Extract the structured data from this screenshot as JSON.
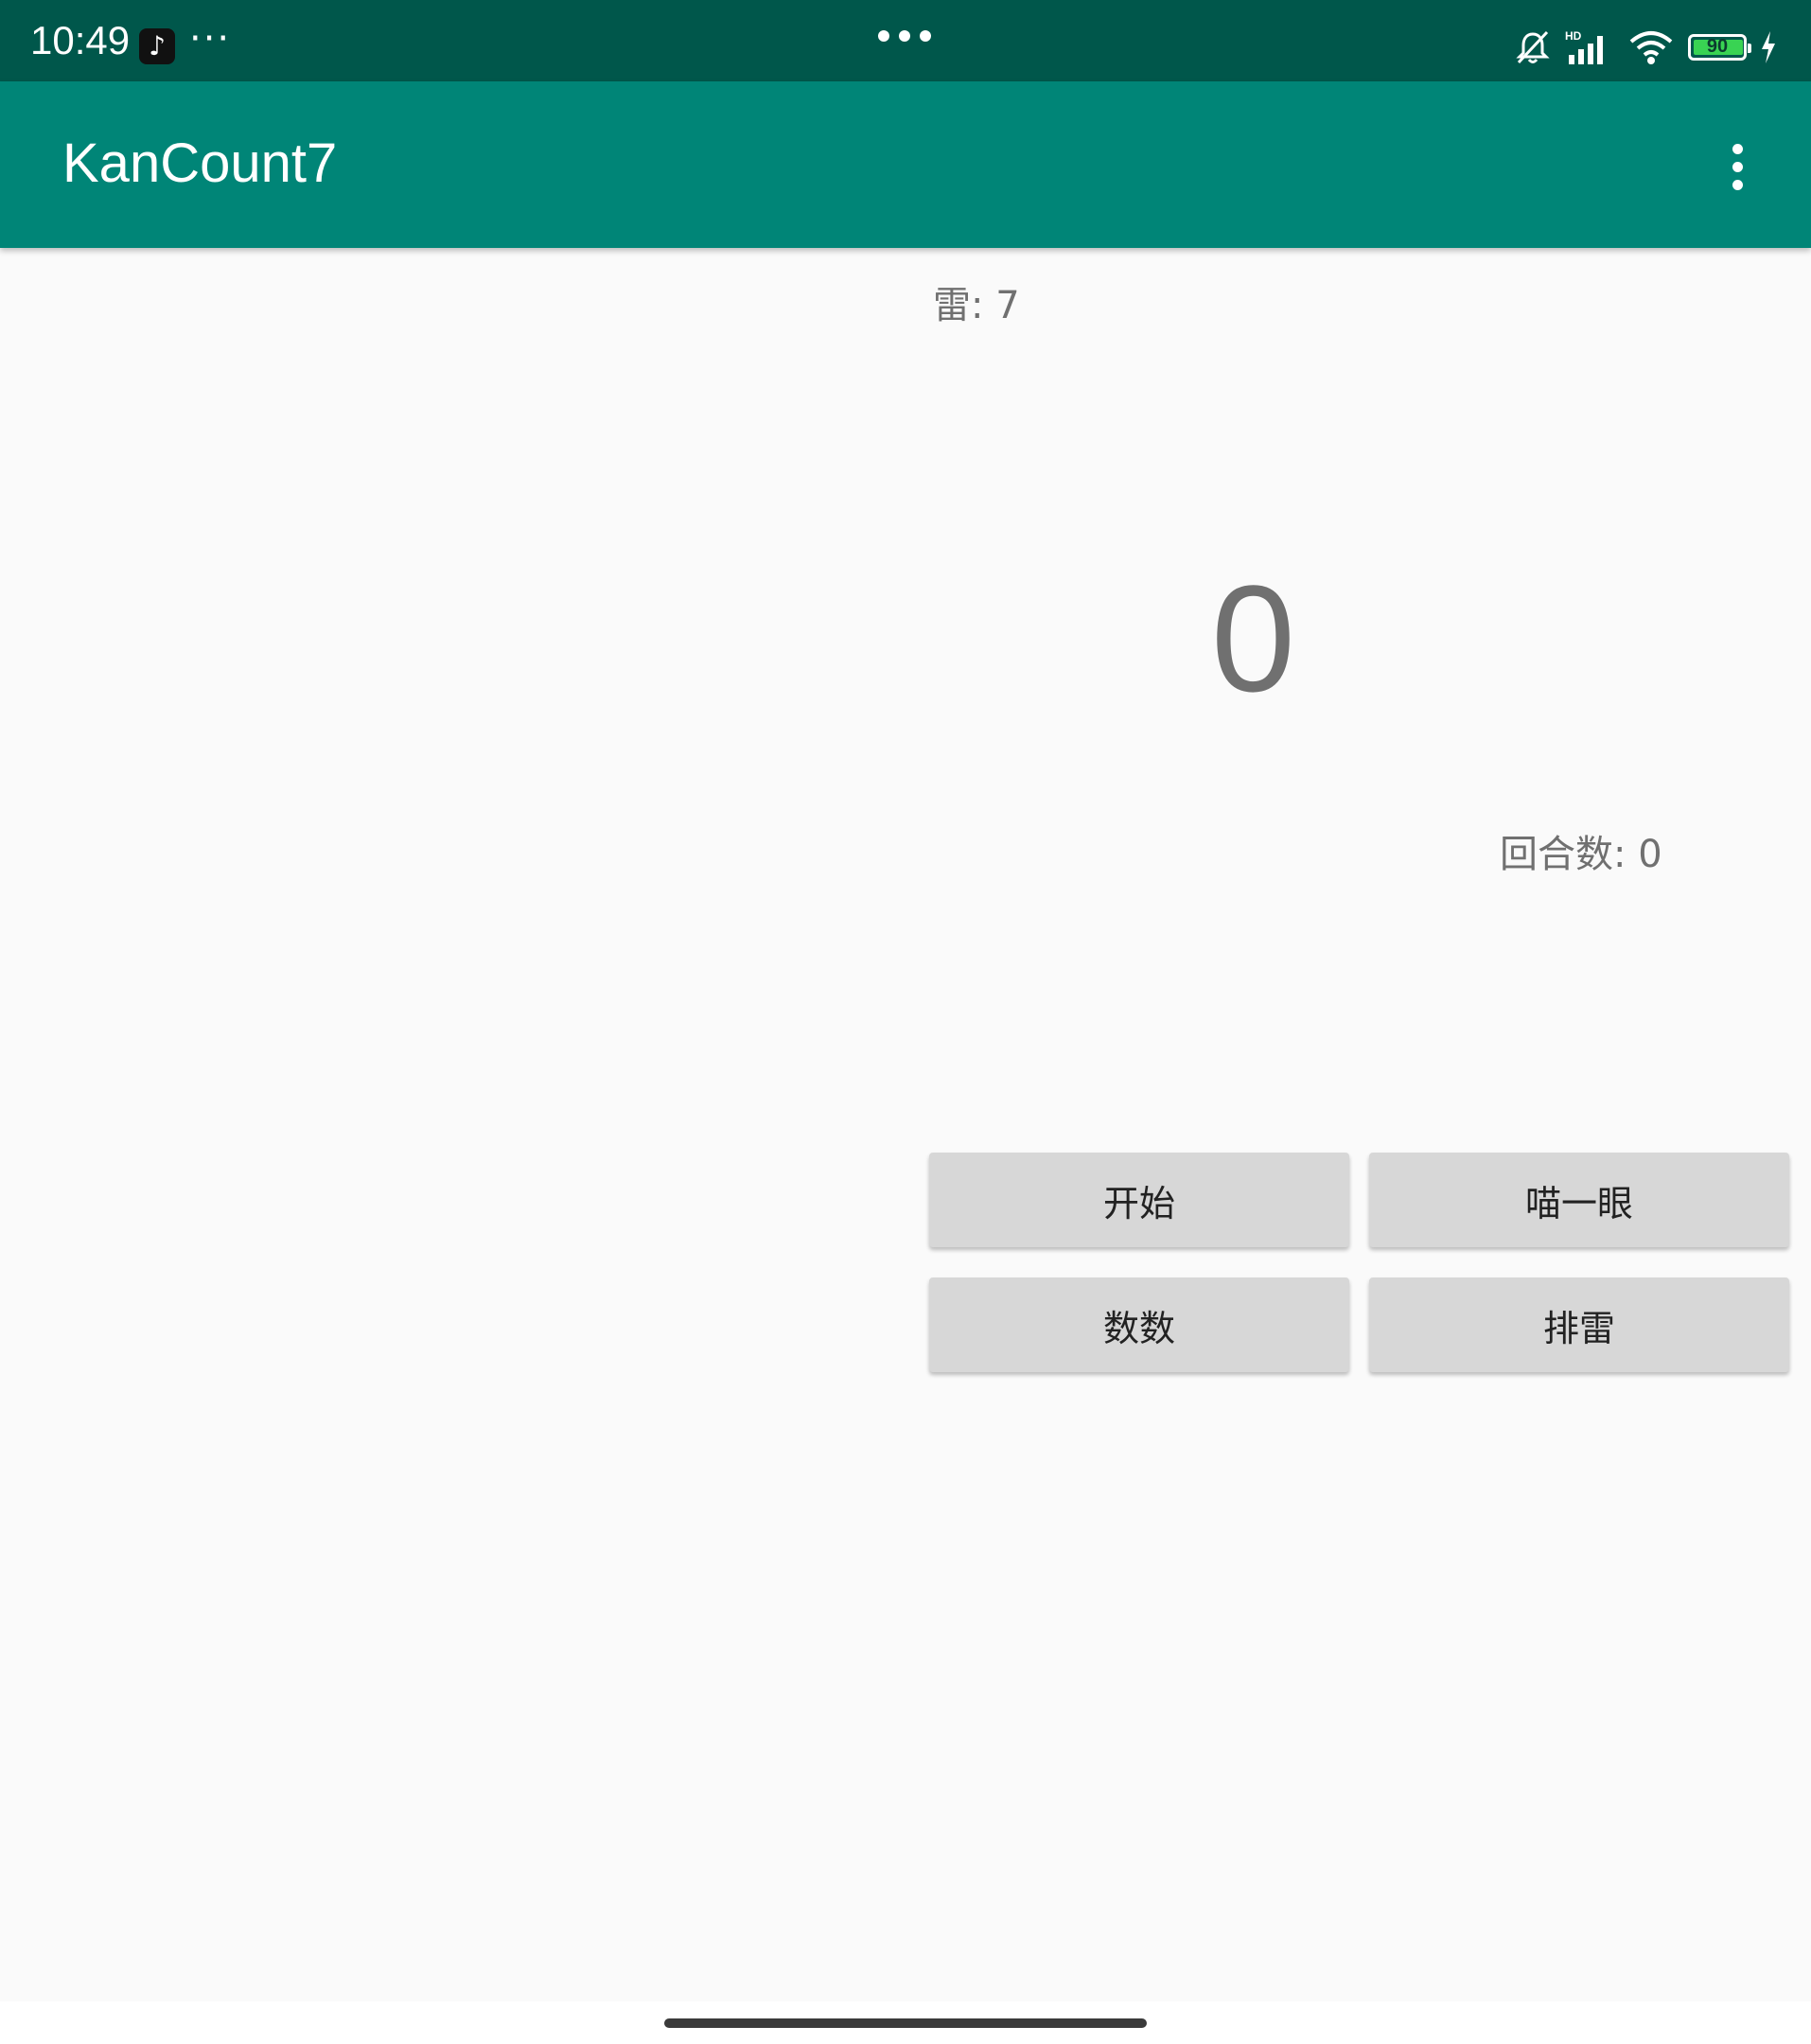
{
  "status_bar": {
    "time": "10:49",
    "more_indicator": "···",
    "battery_level": "90",
    "battery_percent": 90,
    "icons": [
      "tiktok-icon",
      "silent-bell-icon",
      "hd-signal-icon",
      "wifi-icon",
      "battery-icon",
      "charging-icon"
    ],
    "bg_color": "#00574b"
  },
  "app_bar": {
    "title": "KanCount7",
    "bg_color": "#008577"
  },
  "game": {
    "mines_label": "雷: 7",
    "count_value": "0",
    "rounds_label": "回合数: 0"
  },
  "buttons": {
    "start": "开始",
    "peek": "喵一眼",
    "count": "数数",
    "clear_mines": "排雷"
  },
  "colors": {
    "background": "#fafafa",
    "button_bg": "#d7d7d7",
    "text_gray": "#707070"
  }
}
